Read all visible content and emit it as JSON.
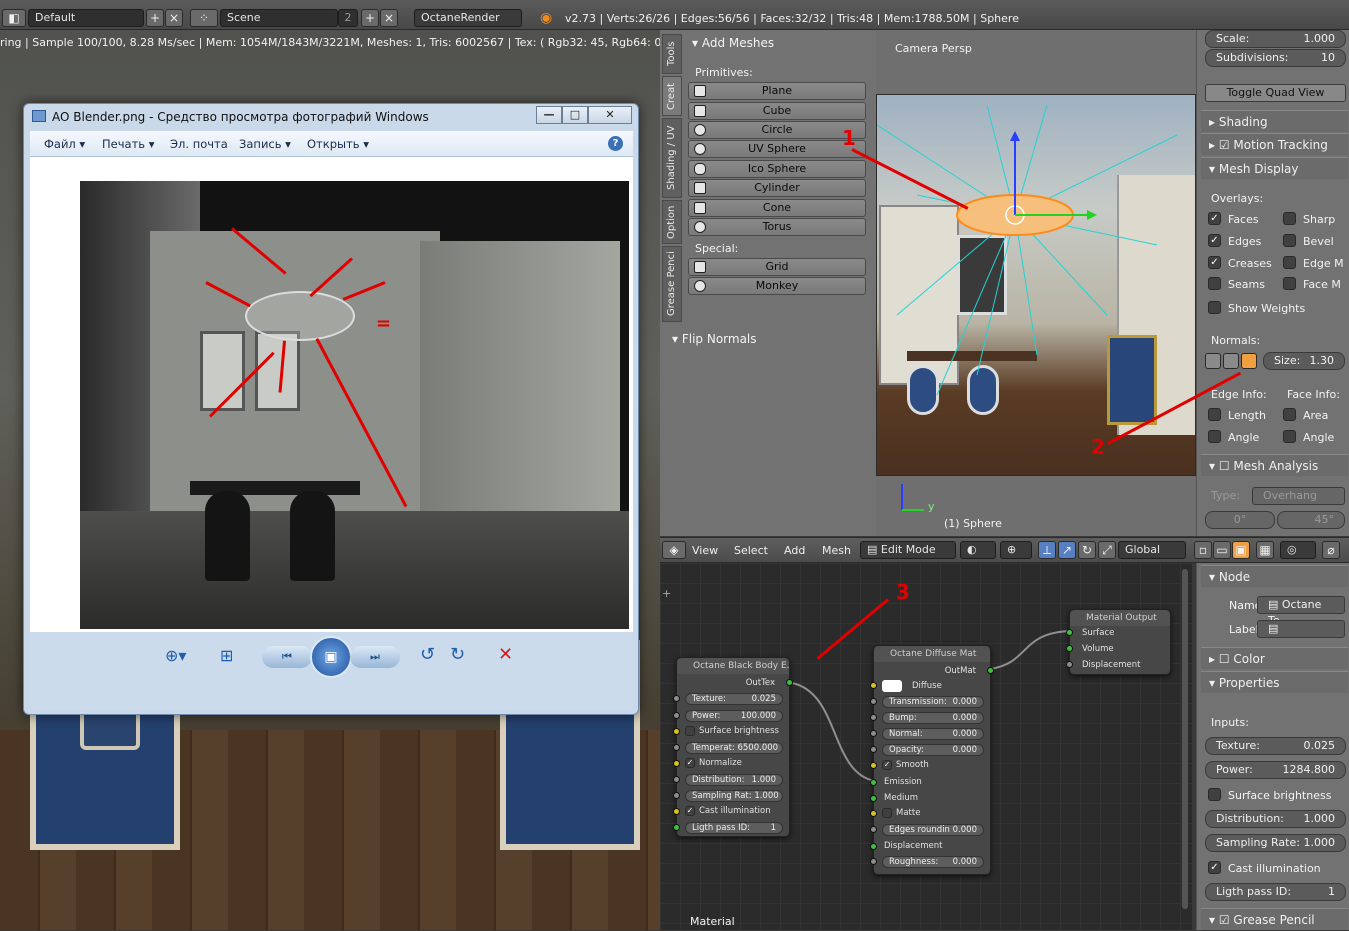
{
  "header": {
    "screen_layout": "Default",
    "scene": "Scene",
    "scene_users": "2",
    "render_engine": "OctaneRender",
    "stats": "v2.73 | Verts:26/26 | Edges:56/56 | Faces:32/32 | Tris:48 | Mem:1788.50M | Sphere"
  },
  "render_info": "ring | Sample 100/100, 8.28 Ms/sec | Mem: 1054M/1843M/3221M, Meshes: 1, Tris: 6002567 | Tex: ( Rgb32: 45, Rgb64: 0, grey8: 0, g",
  "viewer": {
    "title": "AO Blender.png - Средство просмотра фотографий Windows",
    "menu": [
      "Файл",
      "Печать",
      "Эл. почта",
      "Запись",
      "Открыть"
    ],
    "equals_sign": "="
  },
  "tools_panel": {
    "tabs": [
      "Tools",
      "Creat",
      "Shading / UV",
      "Option",
      "Grease Penci"
    ],
    "add_meshes_title": "Add Meshes",
    "primitives_label": "Primitives:",
    "primitives": [
      "Plane",
      "Cube",
      "Circle",
      "UV Sphere",
      "Ico Sphere",
      "Cylinder",
      "Cone",
      "Torus"
    ],
    "special_label": "Special:",
    "special": [
      "Grid",
      "Monkey"
    ],
    "flip_normals": "Flip Normals"
  },
  "viewport": {
    "label": "Camera Persp",
    "object_label": "(1) Sphere",
    "axis_y": "y"
  },
  "properties": {
    "scale_label": "Scale:",
    "scale_value": "1.000",
    "subdiv_label": "Subdivisions:",
    "subdiv_value": "10",
    "toggle_quad": "Toggle Quad View",
    "shading": "Shading",
    "motion_tracking": "Motion Tracking",
    "mesh_display": "Mesh Display",
    "overlays_label": "Overlays:",
    "overlays_left": [
      "Faces",
      "Edges",
      "Creases",
      "Seams",
      "Show Weights"
    ],
    "overlays_right": [
      "Sharp",
      "Bevel",
      "Edge M",
      "Face M"
    ],
    "normals_label": "Normals:",
    "normals_size_label": "Size:",
    "normals_size_value": "1.30",
    "edge_info_label": "Edge Info:",
    "face_info_label": "Face Info:",
    "edge_info": [
      "Length",
      "Angle"
    ],
    "face_info": [
      "Area",
      "Angle"
    ],
    "mesh_analysis": "Mesh Analysis",
    "type_label": "Type:",
    "type_value": "Overhang",
    "angle_min": "0°",
    "angle_max": "45°"
  },
  "view_header": {
    "menus": [
      "View",
      "Select",
      "Add",
      "Mesh"
    ],
    "mode": "Edit Mode",
    "orientation": "Global"
  },
  "node_editor": {
    "blackbody": {
      "title": "Octane Black Body E...",
      "output": "OutTex",
      "texture_label": "Texture:",
      "texture_value": "0.025",
      "power_label": "Power:",
      "power_value": "100.000",
      "surface_brightness": "Surface brightness",
      "temperature": "Temperat: 6500.000",
      "normalize": "Normalize",
      "distribution_label": "Distribution:",
      "distribution_value": "1.000",
      "sampling": "Sampling Rat: 1.000",
      "cast_illumination": "Cast illumination",
      "light_pass_label": "Ligth pass ID:",
      "light_pass_value": "1"
    },
    "diffuse": {
      "title": "Octane Diffuse Mat",
      "output": "OutMat",
      "diffuse": "Diffuse",
      "transmission_label": "Transmission:",
      "transmission_value": "0.000",
      "bump_label": "Bump:",
      "bump_value": "0.000",
      "normal_label": "Normal:",
      "normal_value": "0.000",
      "opacity_label": "Opacity:",
      "opacity_value": "0.000",
      "smooth": "Smooth",
      "emission": "Emission",
      "medium": "Medium",
      "matte": "Matte",
      "edges_rounding": "Edges roundin 0.000",
      "displacement": "Displacement",
      "roughness_label": "Roughness:",
      "roughness_value": "0.000"
    },
    "output": {
      "title": "Material Output",
      "inputs": [
        "Surface",
        "Volume",
        "Displacement"
      ]
    },
    "footer": "Material"
  },
  "node_props": {
    "node": "Node",
    "name_label": "Name:",
    "name_value": "Octane Te...",
    "label_label": "Label:",
    "color": "Color",
    "properties": "Properties",
    "inputs_label": "Inputs:",
    "texture_label": "Texture:",
    "texture_value": "0.025",
    "power_label": "Power:",
    "power_value": "1284.800",
    "surface_brightness": "Surface brightness",
    "distribution_label": "Distribution:",
    "distribution_value": "1.000",
    "sampling_label": "Sampling Rate:",
    "sampling_value": "1.000",
    "cast_illumination": "Cast illumination",
    "light_pass_label": "Ligth pass ID:",
    "light_pass_value": "1",
    "grease_pencil": "Grease Pencil"
  },
  "annotations": [
    "1",
    "2",
    "3"
  ],
  "colors": {
    "accent_red": "#e00000",
    "blender_gray": "#727272",
    "node_socket_yellow": "#d6c21c",
    "node_socket_green": "#3fbf3f"
  }
}
